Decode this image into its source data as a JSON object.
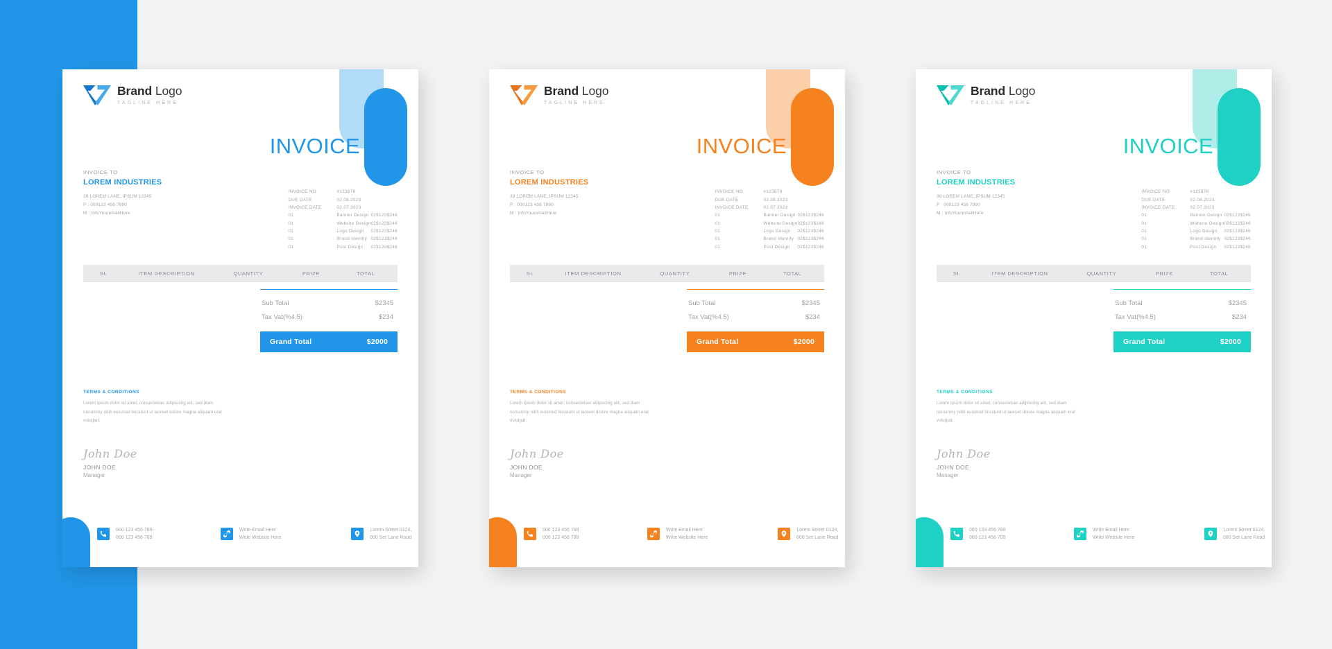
{
  "canvas": {
    "background": "#f2f3f5",
    "brand_panel_color": "#2196e8"
  },
  "invoice": {
    "logo": {
      "title_bold": "Brand",
      "title_light": "Logo",
      "tagline": "TAGLINE HERE",
      "mark": "v-arrow-logo-icon"
    },
    "heading": "INVOICE",
    "bill_to_label": "INVOICE TO",
    "bill_to_name": "LOREM INDUSTRIES",
    "bill_to_lines": [
      "39 LOREM LANE, IPSUM 12345",
      "P : 000123 456 7890",
      "M : InfoYouremailHere"
    ],
    "meta": [
      {
        "key": "INVOICE NO",
        "value": "#123678"
      },
      {
        "key": "DUE DATE",
        "value": "02.08.2023"
      },
      {
        "key": "INVOICE DATE",
        "value": "02.07.2023"
      }
    ],
    "table": {
      "headers": [
        "SL",
        "ITEM DESCRIPTION",
        "QUANTITY",
        "PRIZE",
        "TOTAL"
      ],
      "rows": [
        {
          "sl": "01",
          "desc": "Banner Design",
          "qty": "02",
          "prize": "$123",
          "total": "$246"
        },
        {
          "sl": "01",
          "desc": "Website Design",
          "qty": "02",
          "prize": "$123",
          "total": "$246"
        },
        {
          "sl": "01",
          "desc": "Logo Design",
          "qty": "02",
          "prize": "$123",
          "total": "$246"
        },
        {
          "sl": "01",
          "desc": "Brand Identity",
          "qty": "02",
          "prize": "$123",
          "total": "$246"
        },
        {
          "sl": "01",
          "desc": "Post Design",
          "qty": "02",
          "prize": "$123",
          "total": "$246"
        }
      ]
    },
    "totals": {
      "sub_total_label": "Sub Total",
      "sub_total_value": "$2345",
      "tax_label": "Tax Vat(%4.5)",
      "tax_value": "$234",
      "grand_total_label": "Grand Total",
      "grand_total_value": "$2000"
    },
    "terms": {
      "title": "TERMS & CONDITIONS",
      "body": "Lorem ipsum dolor sit amet, consectetuer adipiscing elit, sed diam nonummy nibh euismod tincidunt ut laoreet dolore magna aliquam erat volutpat."
    },
    "signature": {
      "script": "John Doe",
      "name": "JOHN DOE",
      "role": "Manager"
    },
    "footer": [
      {
        "icon": "phone-icon",
        "line1": "000 123 456 789",
        "line2": "000 123 456 789",
        "align": "left"
      },
      {
        "icon": "link-icon",
        "line1": "Write Email Here",
        "line2": "Write Website Here",
        "align": "left"
      },
      {
        "icon": "location-pin-icon",
        "line1": "Lorem Street 0124,",
        "line2": "000 Set Lane Road",
        "align": "right"
      }
    ]
  },
  "variants": [
    {
      "id": "blue",
      "name": "blue-invoice-card",
      "accent": "#2196e8",
      "accent_light": "#73bdf0",
      "accent_dark": "#1579cf",
      "logo_dark": "#1579cf",
      "logo_light": "#4aa9ea"
    },
    {
      "id": "orange",
      "name": "orange-invoice-card",
      "accent": "#f5821f",
      "accent_light": "#f9a861",
      "accent_dark": "#f05a05",
      "logo_dark": "#e2761a",
      "logo_light": "#f59a3f"
    },
    {
      "id": "teal",
      "name": "teal-invoice-card",
      "accent": "#1fd1c4",
      "accent_light": "#6fdfd6",
      "accent_dark": "#05b8aa",
      "logo_dark": "#09bfb2",
      "logo_light": "#4fd8cd"
    }
  ]
}
